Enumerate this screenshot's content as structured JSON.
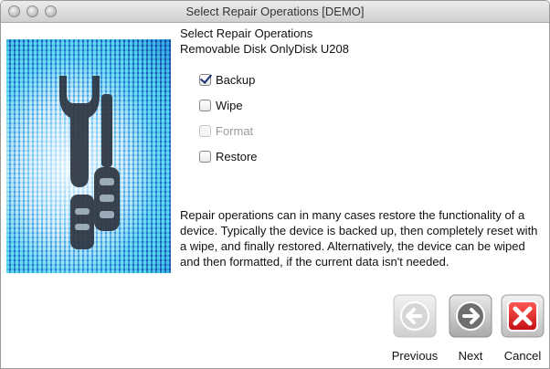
{
  "window": {
    "title": "Select Repair Operations [DEMO]"
  },
  "header": {
    "heading": "Select Repair Operations",
    "device": "Removable Disk  OnlyDisk U208"
  },
  "options": [
    {
      "label": "Backup",
      "checked": true,
      "enabled": true
    },
    {
      "label": "Wipe",
      "checked": false,
      "enabled": true
    },
    {
      "label": "Format",
      "checked": false,
      "enabled": false
    },
    {
      "label": "Restore",
      "checked": false,
      "enabled": true
    }
  ],
  "description": "Repair operations can in many cases restore the functionality of a device. Typically the device is backed up, then completely reset with a wipe, and finally restored. Alternatively, the device can be wiped and then formatted, if the current data isn't needed.",
  "buttons": {
    "previous": {
      "label": "Previous",
      "enabled": false,
      "icon": "left-arrow-icon"
    },
    "next": {
      "label": "Next",
      "enabled": true,
      "icon": "right-arrow-icon"
    },
    "cancel": {
      "label": "Cancel",
      "enabled": true,
      "icon": "red-x-icon"
    }
  },
  "colors": {
    "checkmark": "#1c2f73",
    "cancel_red": "#d8161a",
    "hero_blue": "#3f96d9"
  }
}
